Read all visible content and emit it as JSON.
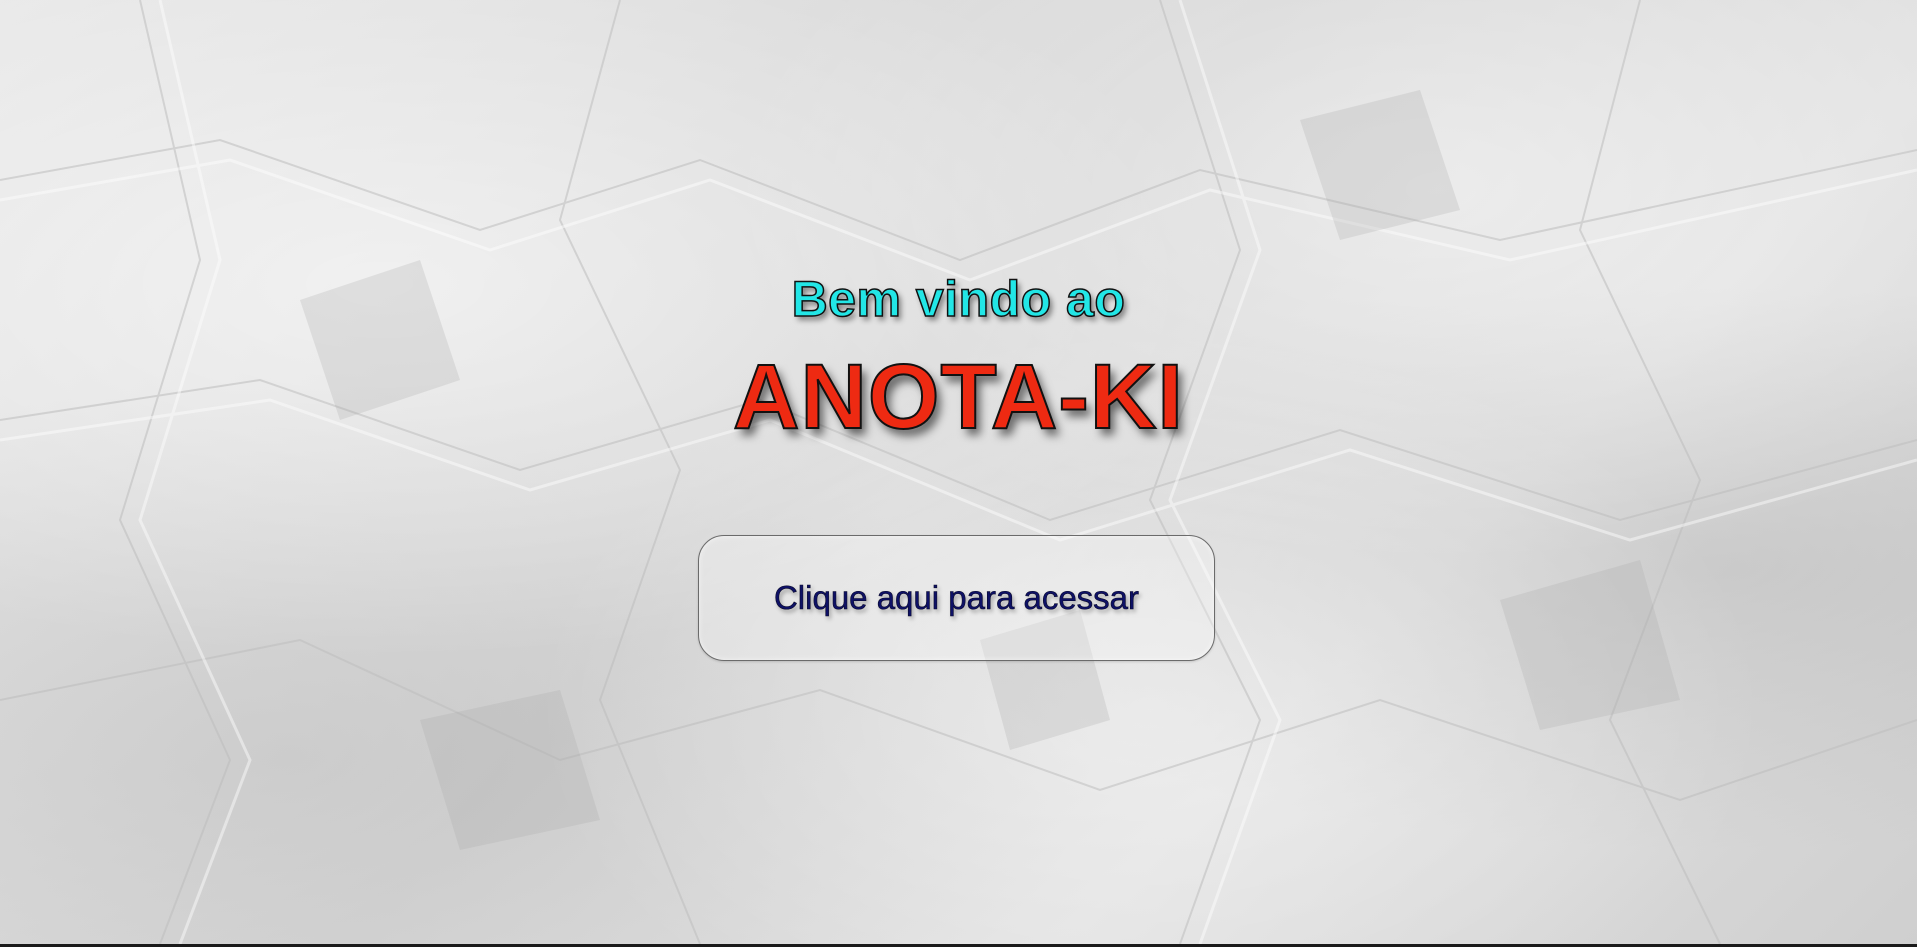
{
  "hero": {
    "welcome_text": "Bem vindo ao",
    "brand_name": "ANOTA-KI"
  },
  "cta": {
    "label": "Clique aqui para acessar"
  },
  "colors": {
    "welcome": "#22e6e6",
    "brand": "#ee2a12",
    "button_text": "#0e1166",
    "background": "#dcdcdc"
  }
}
